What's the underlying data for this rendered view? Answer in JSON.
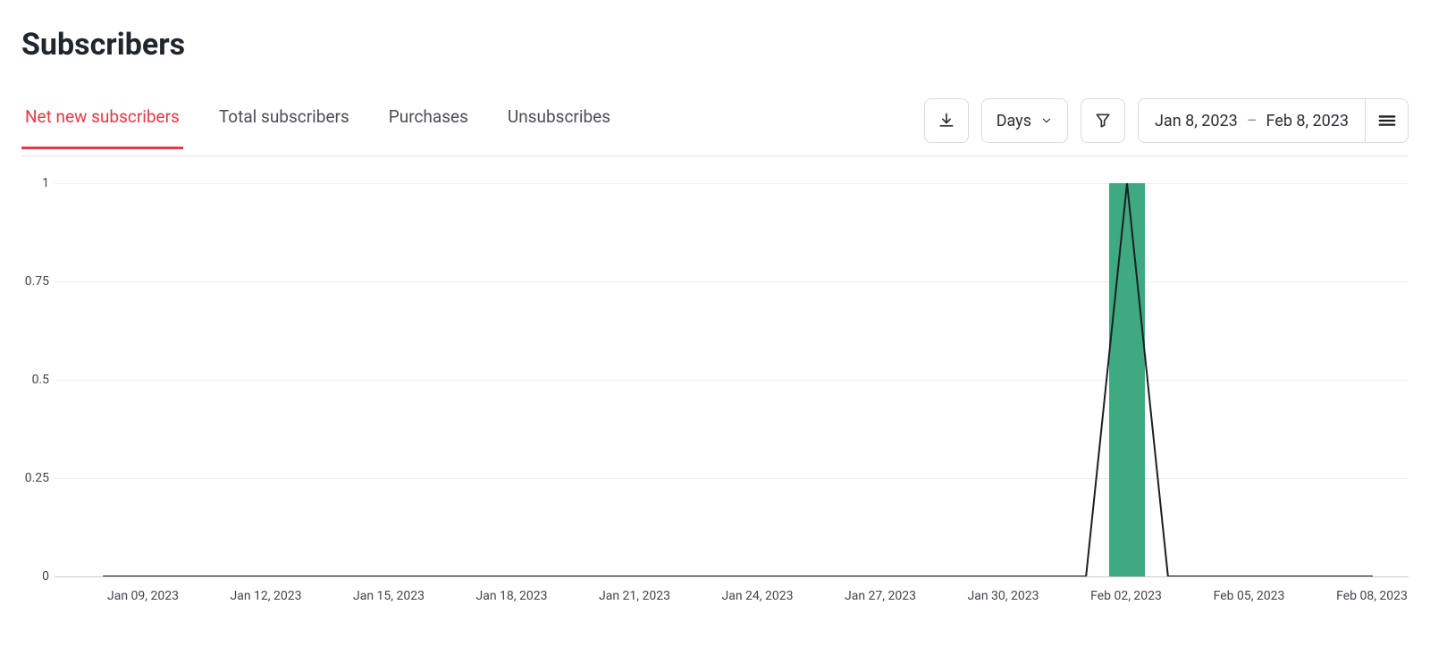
{
  "title": "Subscribers",
  "tabs": [
    {
      "label": "Net new subscribers",
      "active": true
    },
    {
      "label": "Total subscribers",
      "active": false
    },
    {
      "label": "Purchases",
      "active": false
    },
    {
      "label": "Unsubscribes",
      "active": false
    }
  ],
  "controls": {
    "granularity": "Days",
    "date_start": "Jan 8, 2023",
    "date_end": "Feb 8, 2023",
    "date_separator": "–"
  },
  "chart_data": {
    "type": "bar",
    "title": "Net new subscribers",
    "xlabel": "",
    "ylabel": "",
    "ylim": [
      0,
      1
    ],
    "yticks": [
      0,
      0.25,
      0.5,
      0.75,
      1
    ],
    "xticks": [
      "Jan 09, 2023",
      "Jan 12, 2023",
      "Jan 15, 2023",
      "Jan 18, 2023",
      "Jan 21, 2023",
      "Jan 24, 2023",
      "Jan 27, 2023",
      "Jan 30, 2023",
      "Feb 02, 2023",
      "Feb 05, 2023",
      "Feb 08, 2023"
    ],
    "categories": [
      "Jan 08, 2023",
      "Jan 09, 2023",
      "Jan 10, 2023",
      "Jan 11, 2023",
      "Jan 12, 2023",
      "Jan 13, 2023",
      "Jan 14, 2023",
      "Jan 15, 2023",
      "Jan 16, 2023",
      "Jan 17, 2023",
      "Jan 18, 2023",
      "Jan 19, 2023",
      "Jan 20, 2023",
      "Jan 21, 2023",
      "Jan 22, 2023",
      "Jan 23, 2023",
      "Jan 24, 2023",
      "Jan 25, 2023",
      "Jan 26, 2023",
      "Jan 27, 2023",
      "Jan 28, 2023",
      "Jan 29, 2023",
      "Jan 30, 2023",
      "Jan 31, 2023",
      "Feb 01, 2023",
      "Feb 02, 2023",
      "Feb 03, 2023",
      "Feb 04, 2023",
      "Feb 05, 2023",
      "Feb 06, 2023",
      "Feb 07, 2023",
      "Feb 08, 2023"
    ],
    "series": [
      {
        "name": "Net new subscribers (bar)",
        "type": "bar",
        "values": [
          0,
          0,
          0,
          0,
          0,
          0,
          0,
          0,
          0,
          0,
          0,
          0,
          0,
          0,
          0,
          0,
          0,
          0,
          0,
          0,
          0,
          0,
          0,
          0,
          0,
          1,
          0,
          0,
          0,
          0,
          0,
          0
        ]
      },
      {
        "name": "Net new subscribers (line)",
        "type": "line",
        "values": [
          0,
          0,
          0,
          0,
          0,
          0,
          0,
          0,
          0,
          0,
          0,
          0,
          0,
          0,
          0,
          0,
          0,
          0,
          0,
          0,
          0,
          0,
          0,
          0,
          0,
          1,
          0,
          0,
          0,
          0,
          0,
          0
        ]
      }
    ],
    "colors": {
      "bar": "#3fa981",
      "line": "#1b1e23",
      "grid": "#ecedef"
    }
  }
}
